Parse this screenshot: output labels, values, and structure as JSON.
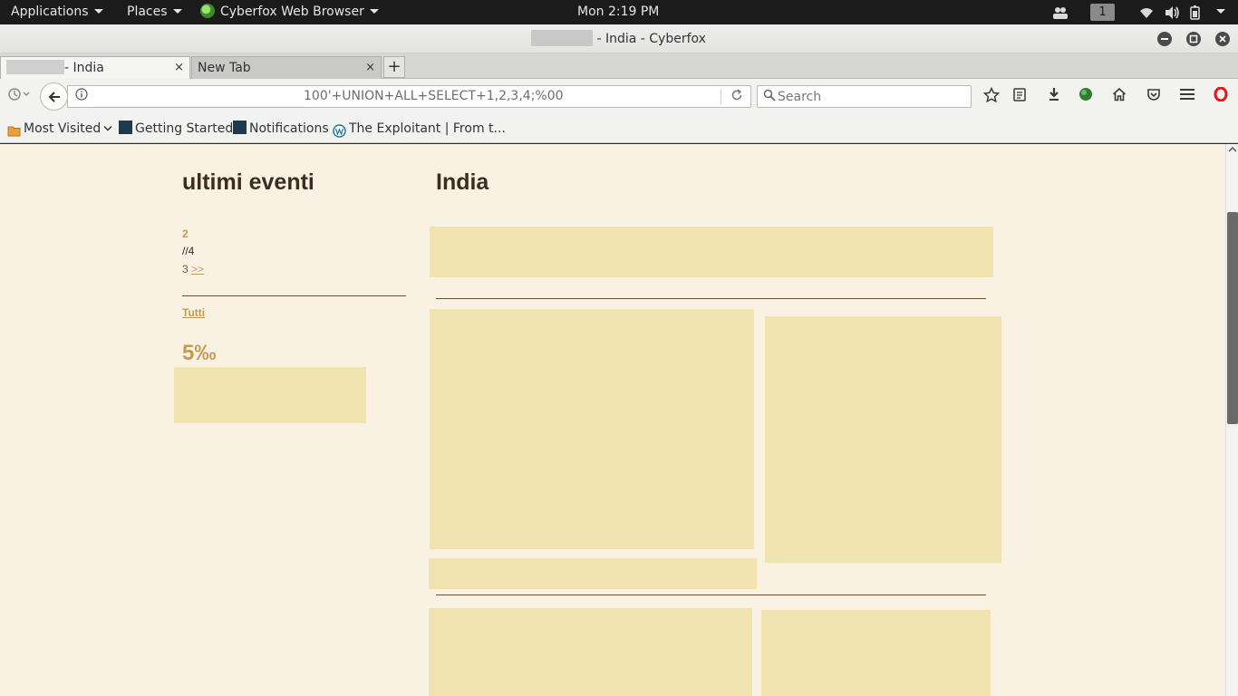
{
  "topbar": {
    "applications_label": "Applications",
    "places_label": "Places",
    "app_label": "Cyberfox Web Browser",
    "clock": "Mon  2:19 PM",
    "workspace": "1"
  },
  "window": {
    "title": "- India - Cyberfox"
  },
  "tabs": [
    {
      "label": "- India",
      "close": "×"
    },
    {
      "label": "New Tab",
      "close": "×"
    }
  ],
  "new_tab_label": "+",
  "navbar": {
    "url_text": "100'+UNION+ALL+SELECT+1,2,3,4;%00",
    "search_placeholder": "Search"
  },
  "bookmarks": [
    {
      "label": "Most Visited"
    },
    {
      "label": "Getting Started"
    },
    {
      "label": "Notifications"
    },
    {
      "label": "The Exploitant | From t..."
    }
  ],
  "page": {
    "sidebar_heading": "ultimi eventi",
    "main_heading": "India",
    "sidebar_lines": {
      "line1": "2",
      "line2": "//4",
      "line3_prefix": "3 ",
      "line3_link": ">>",
      "all_link": "Tutti"
    },
    "sidebar_value": "5‰"
  },
  "colors": {
    "page_bg": "#f9f2e3",
    "ad_fill": "#f0e3af",
    "link_gold": "#c49a53",
    "heading": "#3b2e1f"
  }
}
